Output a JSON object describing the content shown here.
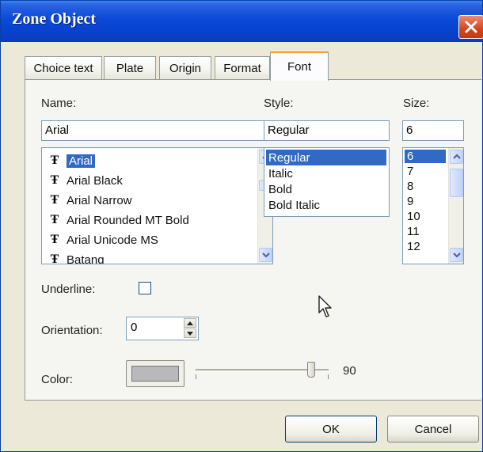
{
  "window": {
    "title": "Zone Object"
  },
  "tabs": [
    {
      "label": "Choice text",
      "active": false
    },
    {
      "label": "Plate",
      "active": false
    },
    {
      "label": "Origin",
      "active": false
    },
    {
      "label": "Format",
      "active": false
    },
    {
      "label": "Font",
      "active": true
    }
  ],
  "font": {
    "name_label": "Name:",
    "name_value": "Arial",
    "name_options": [
      "Arial",
      "Arial Black",
      "Arial Narrow",
      "Arial Rounded MT Bold",
      "Arial Unicode MS",
      "Batang"
    ],
    "name_selected": "Arial",
    "style_label": "Style:",
    "style_value": "Regular",
    "style_options": [
      "Regular",
      "Italic",
      "Bold",
      "Bold Italic"
    ],
    "style_selected": "Regular",
    "size_label": "Size:",
    "size_value": "6",
    "size_options": [
      "6",
      "7",
      "8",
      "9",
      "10",
      "11",
      "12"
    ],
    "size_selected": "6"
  },
  "underline": {
    "label": "Underline:",
    "checked": false
  },
  "orientation": {
    "label": "Orientation:",
    "value": "0"
  },
  "color": {
    "label": "Color:",
    "swatch": "#b9b9bb",
    "slider_value": "90",
    "slider_fraction": 0.9
  },
  "buttons": {
    "ok": "OK",
    "cancel": "Cancel"
  },
  "icons": {
    "close": "close-icon",
    "font_type": "truetype-font-icon",
    "scroll_up": "chevron-up-icon",
    "scroll_down": "chevron-down-icon",
    "spin_up": "triangle-up-icon",
    "spin_down": "triangle-down-icon",
    "cursor": "mouse-pointer-icon"
  },
  "colors": {
    "titlebar": "#0a49d8",
    "selection": "#316ac5",
    "close": "#d6441e",
    "tab_highlight": "#f0a030"
  }
}
